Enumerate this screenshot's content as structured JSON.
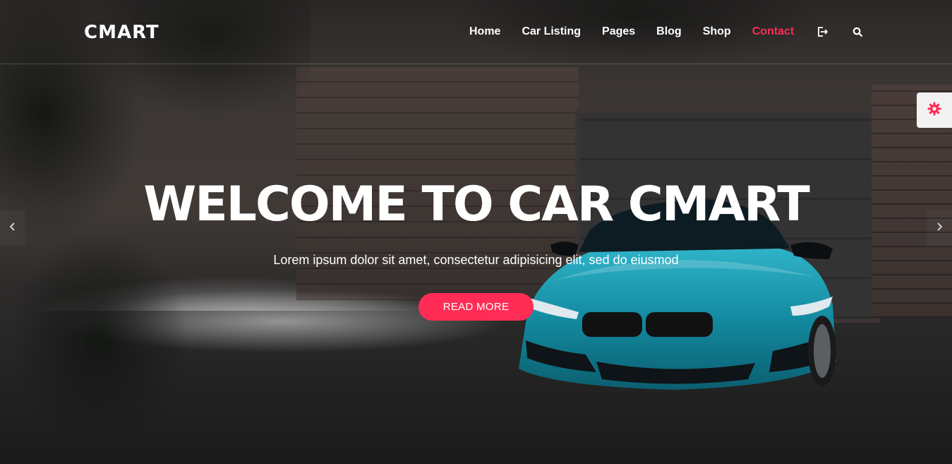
{
  "brand": {
    "logo": "CMART"
  },
  "nav": {
    "items": [
      {
        "label": "Home",
        "active": false
      },
      {
        "label": "Car Listing",
        "active": false
      },
      {
        "label": "Pages",
        "active": false
      },
      {
        "label": "Blog",
        "active": false
      },
      {
        "label": "Shop",
        "active": false
      },
      {
        "label": "Contact",
        "active": true
      }
    ],
    "icons": [
      "logout-icon",
      "search-icon"
    ]
  },
  "hero": {
    "headline": "WELCOME TO CAR CMART",
    "subtitle": "Lorem ipsum dolor sit amet, consectetur adipisicing elit, sed do eiusmod",
    "cta_label": "READ MORE"
  },
  "slider": {
    "prev_icon": "chevron-left-icon",
    "next_icon": "chevron-right-icon"
  },
  "settings": {
    "icon": "gear-icon"
  },
  "colors": {
    "accent": "#ff2d55",
    "text": "#ffffff",
    "settings_bg": "#f2f2f2"
  }
}
